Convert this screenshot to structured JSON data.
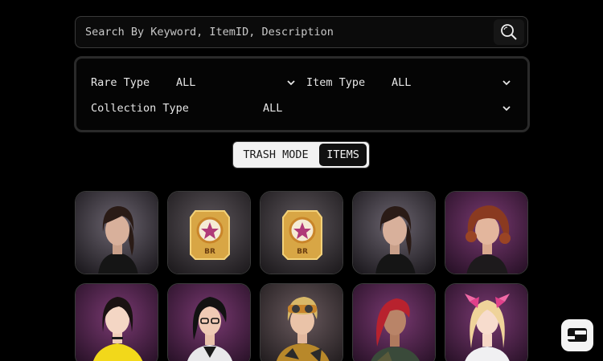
{
  "search": {
    "placeholder": "Search By Keyword, ItemID, Description"
  },
  "filters": {
    "rare_type_label": "Rare Type",
    "rare_type_value": "ALL",
    "item_type_label": "Item Type",
    "item_type_value": "ALL",
    "collection_type_label": "Collection Type",
    "collection_type_value": "ALL"
  },
  "toggle": {
    "trash_mode": "TRASH MODE",
    "items": "ITEMS",
    "active": "items"
  },
  "items": [
    {
      "kind": "female-dark-hair"
    },
    {
      "kind": "br-badge",
      "badge_text": "BR"
    },
    {
      "kind": "br-badge",
      "badge_text": "BR"
    },
    {
      "kind": "female-dark-hair"
    },
    {
      "kind": "female-red-curly"
    },
    {
      "kind": "female-yellow-jacket"
    },
    {
      "kind": "female-glasses"
    },
    {
      "kind": "male-goggles"
    },
    {
      "kind": "female-red-hair"
    },
    {
      "kind": "female-pink-bow"
    }
  ],
  "colors": {
    "card_purple": "#5a2a55",
    "card_dark": "#2e2a30",
    "badge_gold": "#d8a645"
  }
}
